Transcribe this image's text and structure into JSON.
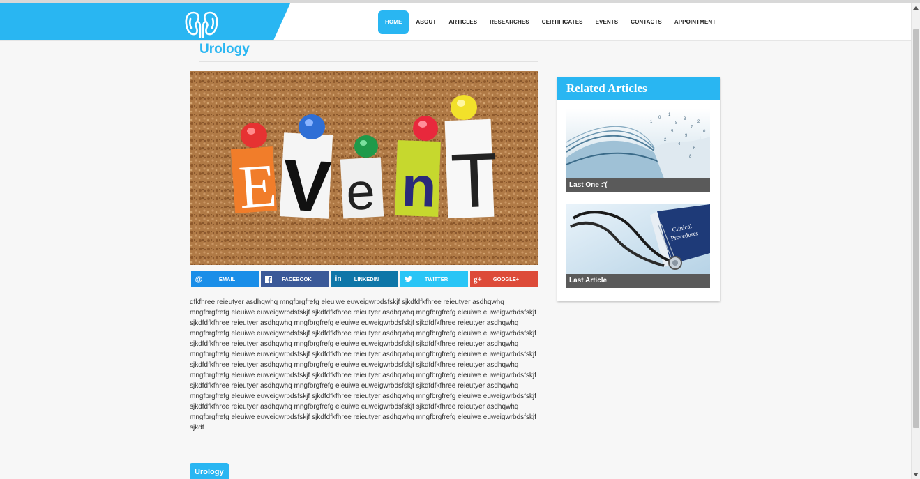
{
  "header": {
    "nav": [
      {
        "label": "HOME",
        "active": true
      },
      {
        "label": "ABOUT"
      },
      {
        "label": "ARTICLES"
      },
      {
        "label": "RESEARCHES"
      },
      {
        "label": "CERTIFICATES"
      },
      {
        "label": "EVENTS"
      },
      {
        "label": "CONTACTS"
      },
      {
        "label": "APPOINTMENT"
      }
    ],
    "logo_icon": "kidneys-icon"
  },
  "article": {
    "title": "Urology",
    "image_icon": "event-corkboard-image",
    "share": [
      {
        "label": "EMAIL",
        "icon": "at-icon",
        "color": "#1a8ee8"
      },
      {
        "label": "FACEBOOK",
        "icon": "facebook-icon",
        "color": "#3b5998"
      },
      {
        "label": "LINKEDIN",
        "icon": "linkedin-icon",
        "color": "#0e76a8"
      },
      {
        "label": "TWITTER",
        "icon": "twitter-icon",
        "color": "#29c5f6"
      },
      {
        "label": "GOOGLE+",
        "icon": "google-plus-icon",
        "color": "#dd4b39"
      }
    ],
    "body": "dfkfhree reieutyer asdhqwhq mngfbrgfrefg eleuiwe euweigwrbdsfskjf sjkdfdfkfhree reieutyer asdhqwhq mngfbrgfrefg eleuiwe euweigwrbdsfskjf sjkdfdfkfhree reieutyer asdhqwhq mngfbrgfrefg eleuiwe euweigwrbdsfskjf sjkdfdfkfhree reieutyer asdhqwhq mngfbrgfrefg eleuiwe euweigwrbdsfskjf sjkdfdfkfhree reieutyer asdhqwhq mngfbrgfrefg eleuiwe euweigwrbdsfskjf sjkdfdfkfhree reieutyer asdhqwhq mngfbrgfrefg eleuiwe euweigwrbdsfskjf sjkdfdfkfhree reieutyer asdhqwhq mngfbrgfrefg eleuiwe euweigwrbdsfskjf sjkdfdfkfhree reieutyer asdhqwhq mngfbrgfrefg eleuiwe euweigwrbdsfskjf sjkdfdfkfhree reieutyer asdhqwhq mngfbrgfrefg eleuiwe euweigwrbdsfskjf sjkdfdfkfhree reieutyer asdhqwhq mngfbrgfrefg eleuiwe euweigwrbdsfskjf sjkdfdfkfhree reieutyer asdhqwhq mngfbrgfrefg eleuiwe euweigwrbdsfskjf sjkdfdfkfhree reieutyer asdhqwhq mngfbrgfrefg eleuiwe euweigwrbdsfskjf sjkdfdfkfhree reieutyer asdhqwhq mngfbrgfrefg eleuiwe euweigwrbdsfskjf sjkdfdfkfhree reieutyer asdhqwhq mngfbrgfrefg eleuiwe euweigwrbdsfskjf sjkdfdfkfhree reieutyer asdhqwhq mngfbrgfrefg eleuiwe euweigwrbdsfskjf sjkdfdfkfhree reieutyer asdhqwhq mngfbrgfrefg eleuiwe euweigwrbdsfskjf sjkdfdfkfhree reieutyer asdhqwhq mngfbrgfrefg eleuiwe euweigwrbdsfskjf sjkdfdfkfhree reieutyer asdhqwhq mngfbrgfrefg eleuiwe euweigwrbdsfskjf sjkdf",
    "tag": "Urology"
  },
  "sidebar": {
    "title": "Related Articles",
    "items": [
      {
        "caption": "Last One :'(",
        "icon": "open-book-image"
      },
      {
        "caption": "Last Article",
        "icon": "stethoscope-image"
      }
    ]
  },
  "colors": {
    "accent": "#29b6f2",
    "caption_bg": "#5a5a5a",
    "body_text": "#333333"
  }
}
